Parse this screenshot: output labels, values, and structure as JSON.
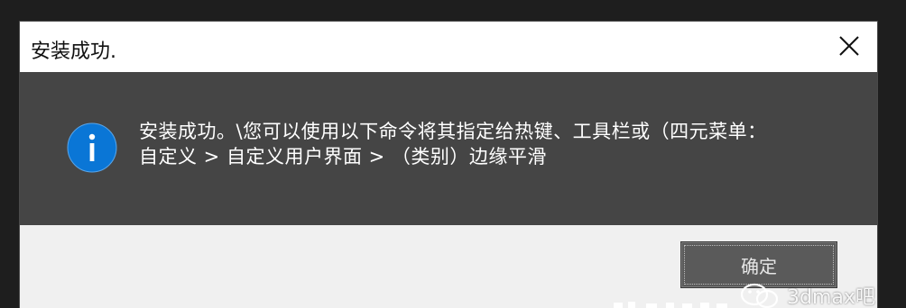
{
  "dialog": {
    "title": "安装成功.",
    "message": "安装成功。\\您可以使用以下命令将其指定给热键、工具栏或（四元菜单：\n自定义 > 自定义用户界面 > （类别）边缘平滑",
    "ok_label": "确定",
    "icon": "info-icon",
    "close_icon": "close-icon"
  },
  "watermark": {
    "text": "3dmax吧"
  },
  "colors": {
    "title_bar": "#ffffff",
    "content_bg": "#454545",
    "footer_bg": "#f0f0f0",
    "info_icon": "#0a76d6",
    "button_bg": "#5a5a5a"
  }
}
